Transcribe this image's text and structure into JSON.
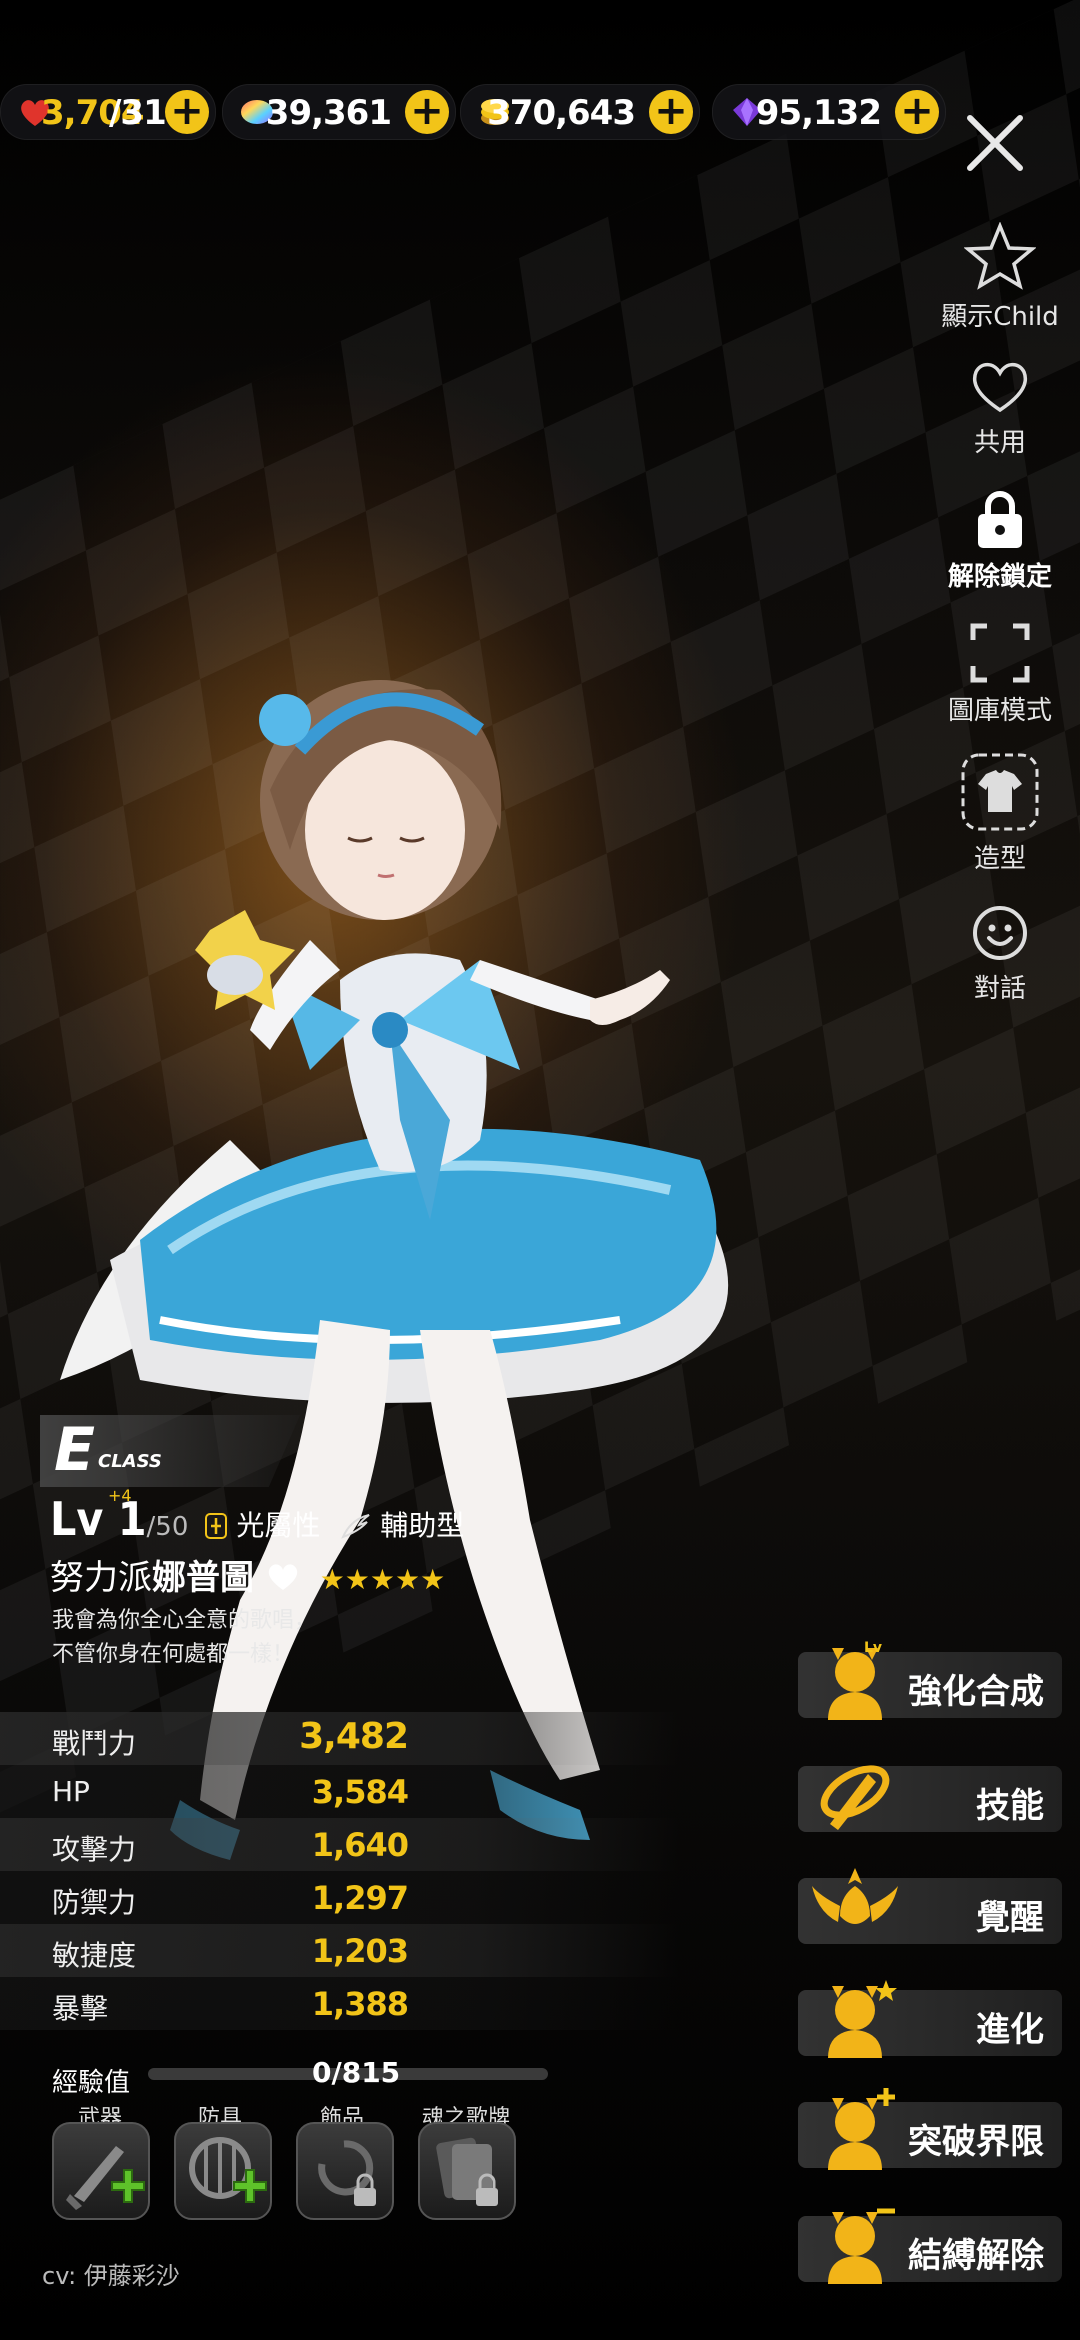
{
  "resources": [
    {
      "icon": "heart-stamina-icon",
      "value": "3,704",
      "max": "/314"
    },
    {
      "icon": "rainbow-gem-icon",
      "value": "39,361"
    },
    {
      "icon": "gold-coin-icon",
      "value": "370,643"
    },
    {
      "icon": "purple-crystal-icon",
      "value": "95,132"
    }
  ],
  "right_menu": [
    {
      "icon": "star-outline-icon",
      "label": "顯示Child"
    },
    {
      "icon": "heart-outline-icon",
      "label": "共用"
    },
    {
      "icon": "lock-icon",
      "label": "解除鎖定"
    },
    {
      "icon": "fullscreen-icon",
      "label": "圖庫模式"
    },
    {
      "icon": "outfit-icon",
      "label": "造型"
    },
    {
      "icon": "smile-icon",
      "label": "對話"
    }
  ],
  "character": {
    "class_letter": "E",
    "class_text": "CLASS",
    "level": "Lv 1",
    "level_max": "/50",
    "level_plus": "+4",
    "attribute": "光屬性",
    "role": "輔助型",
    "title": "努力派",
    "name": "娜普圖",
    "stars": "★★★★★",
    "quote_line1": "我會為你全心全意的歌唱，",
    "quote_line2": "不管你身在何處都一樣！"
  },
  "stats": [
    {
      "label": "戰鬥力",
      "value": "3,482"
    },
    {
      "label": "HP",
      "value": "3,584"
    },
    {
      "label": "攻擊力",
      "value": "1,640"
    },
    {
      "label": "防禦力",
      "value": "1,297"
    },
    {
      "label": "敏捷度",
      "value": "1,203"
    },
    {
      "label": "暴擊",
      "value": "1,388"
    }
  ],
  "exp": {
    "label": "經驗值",
    "value": "0/815",
    "fraction": 0
  },
  "equipment": [
    {
      "label": "武器",
      "state": "add"
    },
    {
      "label": "防具",
      "state": "add"
    },
    {
      "label": "飾品",
      "state": "locked"
    },
    {
      "label": "魂之歌牌",
      "state": "locked"
    }
  ],
  "cv": "cv: 伊藤彩沙",
  "actions": [
    {
      "label": "強化合成",
      "icon": "enhance-icon"
    },
    {
      "label": "技能",
      "icon": "skill-icon"
    },
    {
      "label": "覺醒",
      "icon": "awaken-icon"
    },
    {
      "label": "進化",
      "icon": "evolve-icon"
    },
    {
      "label": "突破界限",
      "icon": "limit-break-icon"
    },
    {
      "label": "結縛解除",
      "icon": "unbind-icon"
    }
  ],
  "colors": {
    "accent": "#f2c418",
    "panel": "#2e2e2e"
  }
}
